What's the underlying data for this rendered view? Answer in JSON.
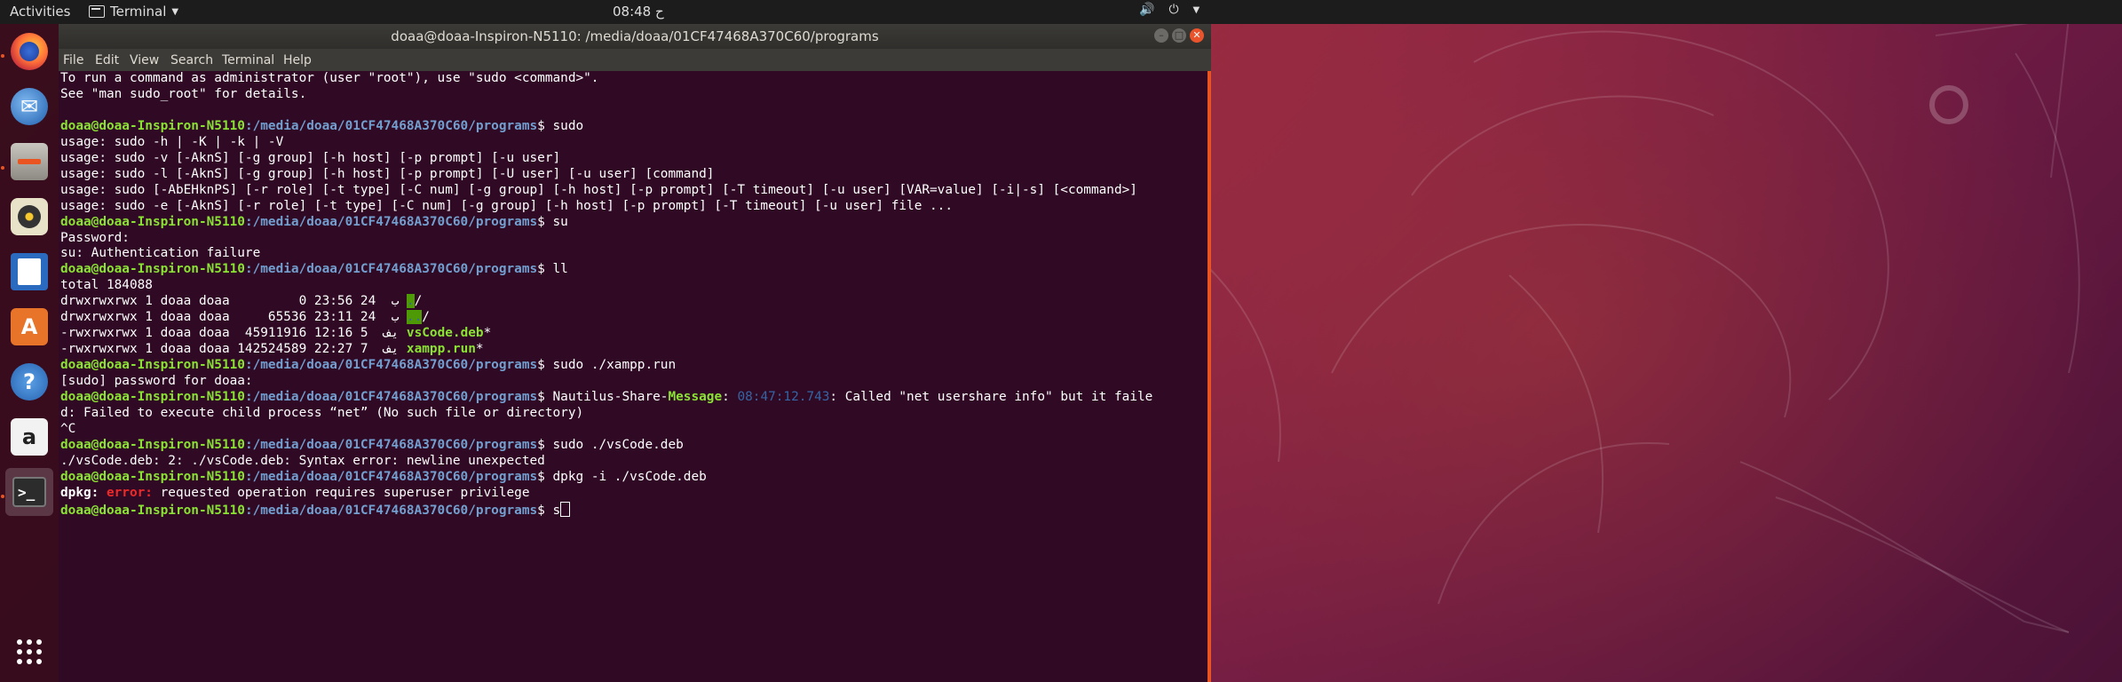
{
  "topbar": {
    "activities": "Activities",
    "app_menu": "Terminal",
    "clock": "08:48 ح"
  },
  "window": {
    "title": "doaa@doaa-Inspiron-N5110: /media/doaa/01CF47468A370C60/programs"
  },
  "menu": [
    "File",
    "Edit",
    "View",
    "Search",
    "Terminal",
    "Help"
  ],
  "launcher_icons": [
    "firefox-icon",
    "thunderbird-icon",
    "files-icon",
    "rhythmbox-icon",
    "writer-icon",
    "software-icon",
    "help-icon",
    "amazon-icon",
    "terminal-icon",
    "show-apps-icon"
  ],
  "prompt": {
    "user": "doaa@doaa-Inspiron-N5110",
    "path": ":/media/doaa/01CF47468A370C60/programs",
    "sign": "$ "
  },
  "terminal": {
    "intro": [
      "To run a command as administrator (user \"root\"), use \"sudo <command>\".",
      "See \"man sudo_root\" for details."
    ],
    "cmd_sudo": "sudo",
    "sudo_usage": [
      "usage: sudo -h | -K | -k | -V",
      "usage: sudo -v [-AknS] [-g group] [-h host] [-p prompt] [-u user]",
      "usage: sudo -l [-AknS] [-g group] [-h host] [-p prompt] [-U user] [-u user] [command]",
      "usage: sudo [-AbEHknPS] [-r role] [-t type] [-C num] [-g group] [-h host] [-p prompt] [-T timeout] [-u user] [VAR=value] [-i|-s] [<command>]",
      "usage: sudo -e [-AknS] [-r role] [-t type] [-C num] [-g group] [-h host] [-p prompt] [-T timeout] [-u user] file ..."
    ],
    "cmd_su": "su",
    "su_output": [
      "Password:",
      "su: Authentication failure"
    ],
    "cmd_ll": "ll",
    "ll_total": "total 184088",
    "ll_rows": [
      {
        "meta": "drwxrwxrwx 1 doaa doaa         0 ",
        "date": "ب  24 23:56 ",
        "name": ".",
        "suffix": "/",
        "type": "dir"
      },
      {
        "meta": "drwxrwxrwx 1 doaa doaa     65536 ",
        "date": "ب  24 23:11 ",
        "name": "..",
        "suffix": "/",
        "type": "dir"
      },
      {
        "meta": "-rwxrwxrwx 1 doaa doaa  45911916 ",
        "date": "يف  5 12:16 ",
        "name": "vsCode.deb",
        "suffix": "*",
        "type": "exec"
      },
      {
        "meta": "-rwxrwxrwx 1 doaa doaa 142524589 ",
        "date": "يف  7 22:27 ",
        "name": "xampp.run",
        "suffix": "*",
        "type": "exec"
      }
    ],
    "cmd_xampp": "sudo ./xampp.run",
    "sudo_password": "[sudo] password for doaa:",
    "nautilus": {
      "cmd": "Nautilus-Share-",
      "label": "Message",
      "colon": ": ",
      "time": "08:47:12.743",
      "text": ": Called \"net usershare info\" but it faile",
      "wrap": "d: Failed to execute child process “net” (No such file or directory)"
    },
    "ctrl_c": "^C",
    "cmd_vscode": "sudo ./vsCode.deb",
    "vscode_error": "./vsCode.deb: 2: ./vsCode.deb: Syntax error: newline unexpected",
    "cmd_dpkg": "dpkg -i ./vsCode.deb",
    "dpkg_prefix": "dpkg: ",
    "dpkg_error_label": "error:",
    "dpkg_message": " requested operation requires superuser privilege",
    "current_input": "s"
  },
  "colors": {
    "terminal_bg": "#300a24",
    "prompt_user": "#8ae234",
    "prompt_path": "#729fcf",
    "error": "#ef2929",
    "accent": "#e95420"
  }
}
